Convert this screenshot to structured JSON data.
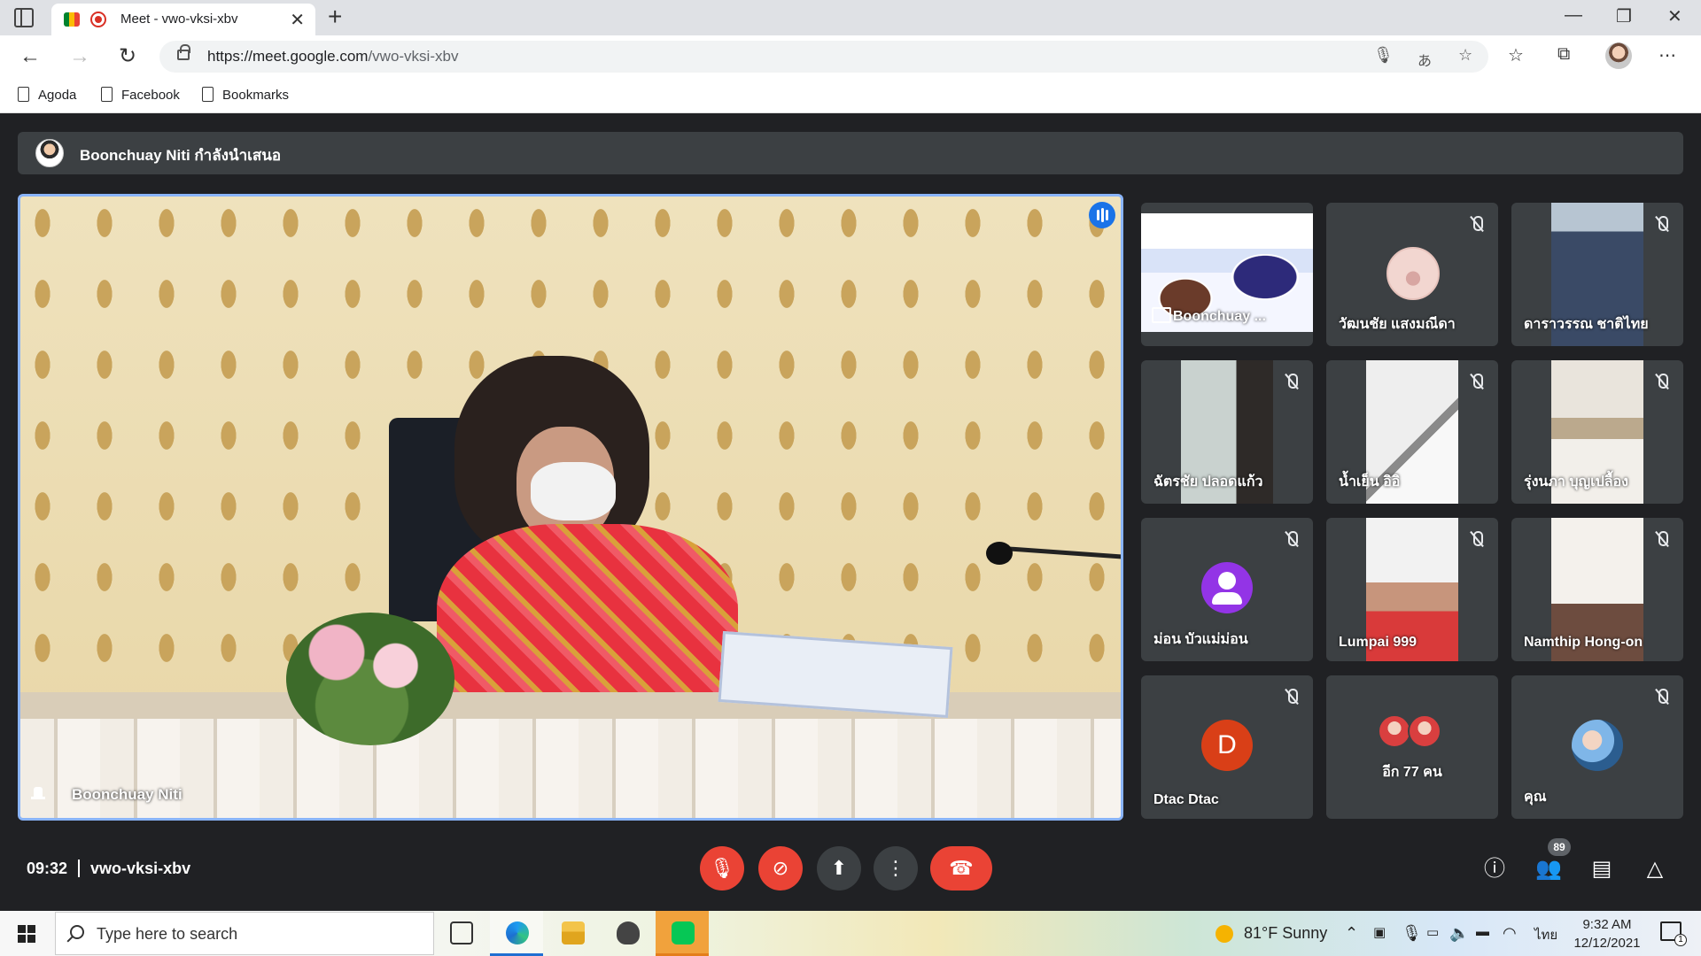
{
  "browser": {
    "tab_title": "Meet - vwo-vksi-xbv",
    "tab_close": "✕",
    "new_tab": "+",
    "url_host": "https://meet.google.com",
    "url_path": "/vwo-vksi-xbv",
    "bookmarks": [
      "Agoda",
      "Facebook",
      "Bookmarks"
    ]
  },
  "meet": {
    "presenting_text": "Boonchuay Niti กำลังนำเสนอ",
    "main_speaker": "Boonchuay Niti",
    "time": "09:32",
    "meeting_code": "vwo-vksi-xbv",
    "participant_count": "89",
    "tiles": [
      {
        "name": "Boonchuay ...",
        "kind": "presentation",
        "muted": false
      },
      {
        "name": "วัฒนชัย แสงมณีดา",
        "kind": "avatar-pig",
        "muted": true
      },
      {
        "name": "ดาราวรรณ ชาติไทย",
        "kind": "camera",
        "muted": true
      },
      {
        "name": "ฉัตรชัย ปลอดแก้ว",
        "kind": "camera",
        "muted": true
      },
      {
        "name": "น้ำเย็น อิอิ",
        "kind": "camera",
        "muted": true
      },
      {
        "name": "รุ่งนภา บุญเปลื้อง",
        "kind": "camera",
        "muted": true
      },
      {
        "name": "ม่อน บัวแม่ม่อน",
        "kind": "avatar-default",
        "muted": true
      },
      {
        "name": "Lumpai 999",
        "kind": "camera",
        "muted": true
      },
      {
        "name": "Namthip Hong-on",
        "kind": "camera",
        "muted": true
      },
      {
        "name": "Dtac Dtac",
        "kind": "letter",
        "letter": "D",
        "muted": true
      },
      {
        "name": "อีก 77 คน",
        "kind": "others",
        "muted": false
      },
      {
        "name": "คุณ",
        "kind": "self",
        "muted": true
      }
    ]
  },
  "taskbar": {
    "search_placeholder": "Type here to search",
    "weather": "81°F  Sunny",
    "language": "ไทย",
    "time": "9:32 AM",
    "date": "12/12/2021",
    "notification_count": "1"
  },
  "colors": {
    "meet_bg": "#202124",
    "tile_bg": "#3c4043",
    "end_red": "#ea4335",
    "active_blue": "#8ab4f8"
  }
}
